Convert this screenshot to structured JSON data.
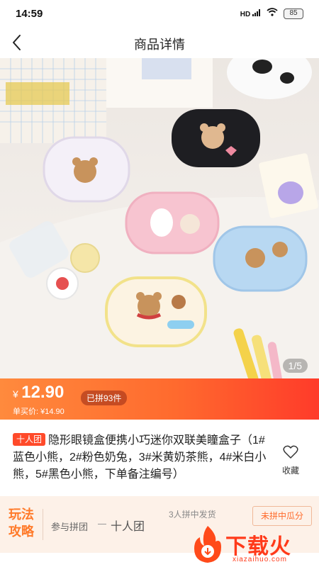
{
  "status": {
    "time": "14:59",
    "signal": "HD",
    "battery": "85"
  },
  "nav": {
    "title": "商品详情"
  },
  "gallery": {
    "page_indicator": "1/5"
  },
  "price": {
    "symbol": "¥",
    "value": "12.90",
    "unit_price": "单买价: ¥14.90",
    "group_count": "已拼93件"
  },
  "product": {
    "tag": "十人团",
    "title": "隐形眼镜盒便携小巧迷你双联美瞳盒子（1#蓝色小熊，2#粉色奶兔，3#米黄奶茶熊，4#米白小熊，5#黑色小熊，下单备注编号）",
    "favorite_label": "收藏"
  },
  "play": {
    "title": "玩法攻略",
    "join_label": "参与拼团",
    "team_size": "十人团",
    "success_rule": "3人拼中发货",
    "fail_rule": "未拼中瓜分"
  },
  "watermark": {
    "text": "下载火",
    "url": "xiazaihuo.com"
  },
  "colors": {
    "accent": "#ff5a2a",
    "banner_start": "#ff8a3d",
    "banner_end": "#ff3b2a"
  }
}
